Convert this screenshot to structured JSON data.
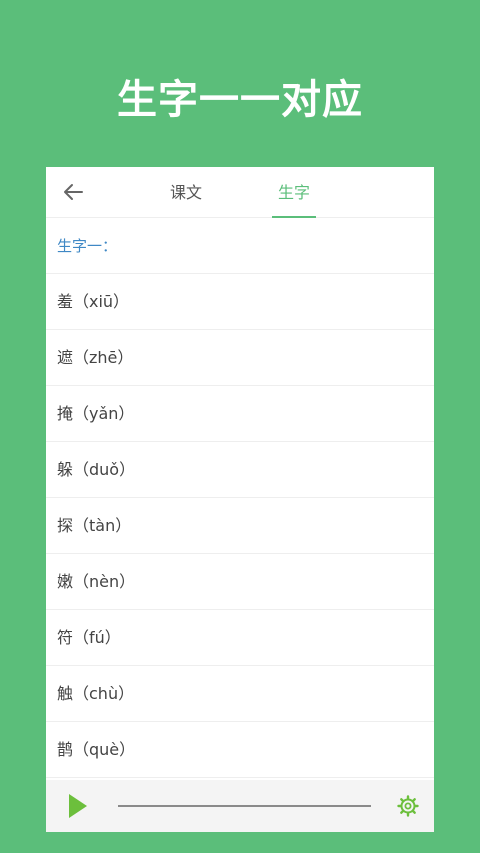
{
  "hero": {
    "title": "生字一一对应"
  },
  "header": {
    "back_icon": "arrow-left-icon",
    "tabs": [
      {
        "label": "课文",
        "active": false
      },
      {
        "label": "生字",
        "active": true
      }
    ]
  },
  "section": {
    "label": "生字一："
  },
  "characters": [
    "羞（xiū）",
    "遮（zhē）",
    "掩（yǎn）",
    "躲（duǒ）",
    "探（tàn）",
    "嫩（nèn）",
    "符（fú）",
    "触（chù）",
    "鹊（què）"
  ],
  "player": {
    "play_icon": "play-icon",
    "settings_icon": "gear-icon"
  },
  "colors": {
    "background": "#5bbe7a",
    "accent": "#5bbe7a",
    "section_label": "#3f88c5",
    "text": "#444444"
  }
}
